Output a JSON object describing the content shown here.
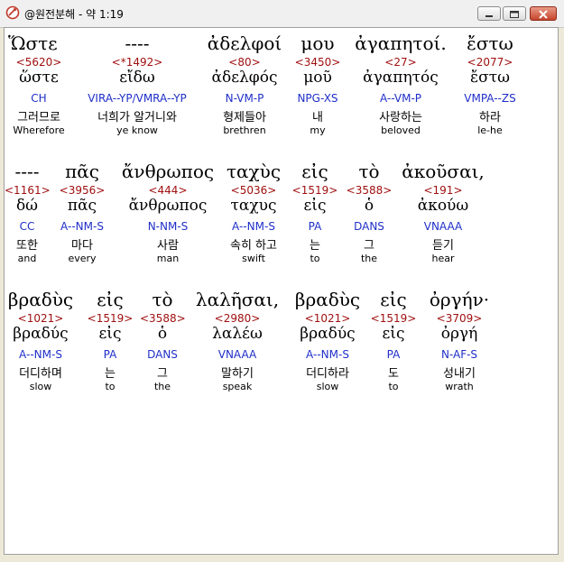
{
  "window": {
    "title": "@원전분해 - 약 1:19"
  },
  "rows": [
    {
      "blocks": [
        {
          "gk": "Ὥστε",
          "strong": "<5620>",
          "lex": "ὥστε",
          "parse": "CH",
          "ko": "그러므로",
          "en": "Wherefore"
        },
        {
          "gk": "----",
          "strong": "<*1492>",
          "lex": "εἴδω",
          "parse": "VIRA--YP/VMRA--YP",
          "ko": "너희가 알거니와",
          "en": "ye know"
        },
        {
          "gk": "ἀδελφοί",
          "strong": "<80>",
          "lex": "ἀδελφός",
          "parse": "N-VM-P",
          "ko": "형제들아",
          "en": "brethren"
        },
        {
          "gk": "μου",
          "strong": "<3450>",
          "lex": "μοῦ",
          "parse": "NPG-XS",
          "ko": "내",
          "en": "my"
        },
        {
          "gk": "ἀγαπητοί.",
          "strong": "<27>",
          "lex": "ἀγαπητός",
          "parse": "A--VM-P",
          "ko": "사랑하는",
          "en": "beloved"
        },
        {
          "gk": "ἔστω",
          "strong": "<2077>",
          "lex": "ἔστω",
          "parse": "VMPA--ZS",
          "ko": "하라",
          "en": "le-he"
        }
      ]
    },
    {
      "blocks": [
        {
          "gk": "----",
          "strong": "<1161>",
          "lex": "δώ",
          "parse": "CC",
          "ko": "또한",
          "en": "and"
        },
        {
          "gk": "πᾶς",
          "strong": "<3956>",
          "lex": "πᾶς",
          "parse": "A--NM-S",
          "ko": "마다",
          "en": "every"
        },
        {
          "gk": "ἄνθρωπος",
          "strong": "<444>",
          "lex": "ἄνθρωπος",
          "parse": "N-NM-S",
          "ko": "사람",
          "en": "man"
        },
        {
          "gk": "ταχὺς",
          "strong": "<5036>",
          "lex": "ταχυς",
          "parse": "A--NM-S",
          "ko": "속히 하고",
          "en": "swift"
        },
        {
          "gk": "εἰς",
          "strong": "<1519>",
          "lex": "εἰς",
          "parse": "PA",
          "ko": "는",
          "en": "to"
        },
        {
          "gk": "τὸ",
          "strong": "<3588>",
          "lex": "ὁ",
          "parse": "DANS",
          "ko": "그",
          "en": "the"
        },
        {
          "gk": "ἀκοῦσαι,",
          "strong": "<191>",
          "lex": "ἀκούω",
          "parse": "VNAAA",
          "ko": "듣기",
          "en": "hear"
        }
      ]
    },
    {
      "blocks": [
        {
          "gk": "βραδὺς",
          "strong": "<1021>",
          "lex": "βραδύς",
          "parse": "A--NM-S",
          "ko": "더디하며",
          "en": "slow"
        },
        {
          "gk": "εἰς",
          "strong": "<1519>",
          "lex": "εἰς",
          "parse": "PA",
          "ko": "는",
          "en": "to"
        },
        {
          "gk": "τὸ",
          "strong": "<3588>",
          "lex": "ὁ",
          "parse": "DANS",
          "ko": "그",
          "en": "the"
        },
        {
          "gk": "λαλῆσαι,",
          "strong": "<2980>",
          "lex": "λαλέω",
          "parse": "VNAAA",
          "ko": "말하기",
          "en": "speak"
        },
        {
          "gk": "βραδὺς",
          "strong": "<1021>",
          "lex": "βραδύς",
          "parse": "A--NM-S",
          "ko": "더디하라",
          "en": "slow"
        },
        {
          "gk": "εἰς",
          "strong": "<1519>",
          "lex": "εἰς",
          "parse": "PA",
          "ko": "도",
          "en": "to"
        },
        {
          "gk": "ὀργήν·",
          "strong": "<3709>",
          "lex": "ὀργή",
          "parse": "N-AF-S",
          "ko": "성내기",
          "en": "wrath"
        }
      ]
    }
  ]
}
